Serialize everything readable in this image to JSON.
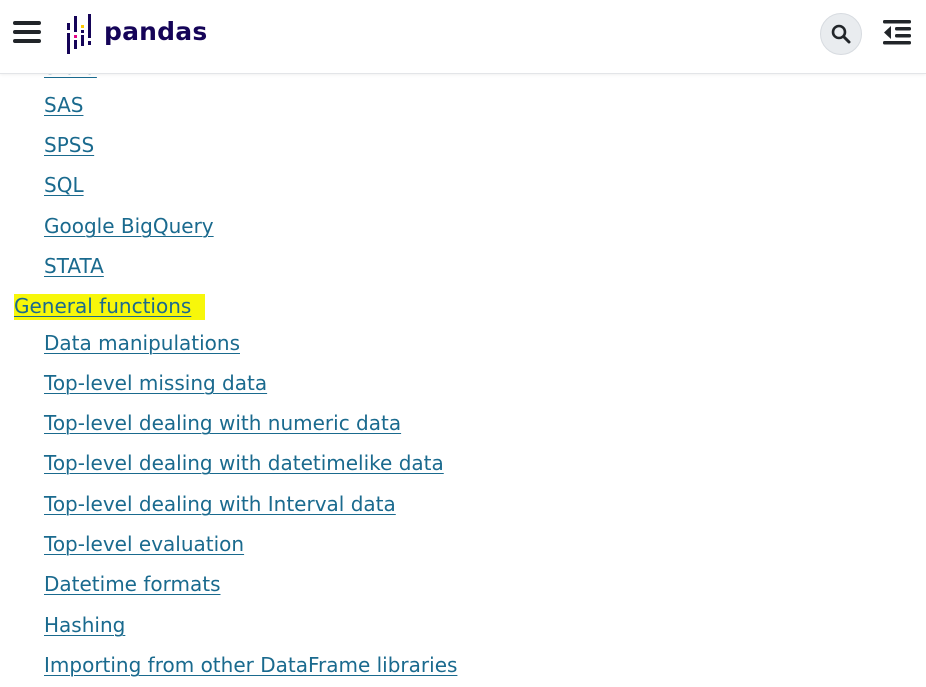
{
  "header": {
    "logo_text": "pandas",
    "menu_icon": "hamburger-menu-icon",
    "search_icon": "search-icon",
    "toc_icon": "outdent-icon"
  },
  "toc": {
    "partial_item": "Stata",
    "items_before": [
      {
        "label": "SAS"
      },
      {
        "label": "SPSS"
      },
      {
        "label": "SQL"
      },
      {
        "label": "Google BigQuery"
      },
      {
        "label": "STATA"
      }
    ],
    "section": "General functions",
    "items_after": [
      {
        "label": "Data manipulations"
      },
      {
        "label": "Top-level missing data"
      },
      {
        "label": "Top-level dealing with numeric data"
      },
      {
        "label": "Top-level dealing with datetimelike data"
      },
      {
        "label": "Top-level dealing with Interval data"
      },
      {
        "label": "Top-level evaluation"
      },
      {
        "label": "Datetime formats"
      },
      {
        "label": "Hashing"
      },
      {
        "label": "Importing from other DataFrame libraries"
      }
    ]
  },
  "colors": {
    "link": "#1a6a8e",
    "highlight": "#f7f70a",
    "brand": "#150458"
  }
}
